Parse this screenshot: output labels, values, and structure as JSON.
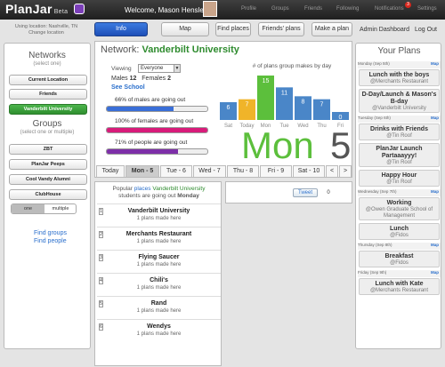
{
  "topbar": {
    "logo": "PlanJar",
    "beta": "Beta",
    "welcome": "Welcome, Mason Hensley",
    "nav": [
      "Profile",
      "Groups",
      "Friends",
      "Following",
      "Notifications",
      "Settings"
    ],
    "notification_count": "3"
  },
  "subbar": {
    "location_line1": "Using location: Nashville, TN",
    "location_line2": "Change location",
    "info_button": "Info",
    "map_button": "Map",
    "find_places": "Find places",
    "friends_plans": "Friends' plans",
    "make_plan": "Make a plan",
    "admin_dashboard": "Admin Dashboard",
    "logout": "Log Out"
  },
  "left": {
    "networks_title": "Networks",
    "networks_sub": "(select one)",
    "networks": [
      "Current Location",
      "Friends",
      "Vanderbilt University"
    ],
    "groups_title": "Groups",
    "groups_sub": "(select one or multiple)",
    "groups": [
      "ZBT",
      "PlanJar Peeps",
      "Cool Vandy Alumni",
      "ClubHouse"
    ],
    "toggle_one": "one",
    "toggle_multiple": "multiple",
    "find_groups": "Find groups",
    "find_people": "Find people"
  },
  "main": {
    "network_label": "Network:",
    "network_name": "Vanderbilt University",
    "viewing_label": "Viewing",
    "viewing_value": "Everyone",
    "males_label": "Males",
    "males_count": "12",
    "females_label": "Females",
    "females_count": "2",
    "see_school": "See School",
    "stats": [
      {
        "text": "66% of males are going out",
        "pct": 66,
        "color": "#3a6fd8"
      },
      {
        "text": "100% of females are going out",
        "pct": 100,
        "color": "#d81b7a"
      },
      {
        "text": "71% of people are going out",
        "pct": 71,
        "color": "#7d2fa8"
      }
    ],
    "chart_caption": "# of plans group makes by day",
    "big_day": "Mon",
    "big_num": "5",
    "day_tabs": [
      "Today",
      "Mon - 5",
      "Tue - 6",
      "Wed - 7",
      "Thu - 8",
      "Fri - 9",
      "Sat - 10",
      "<",
      ">"
    ]
  },
  "chart_data": {
    "type": "bar",
    "categories": [
      "Sat",
      "Today",
      "Mon",
      "Tue",
      "Wed",
      "Thu",
      "Fri"
    ],
    "values": [
      6,
      7,
      15,
      11,
      8,
      7,
      0
    ],
    "highlight": "Mon",
    "colors": [
      "#4a86c8",
      "#f0b429",
      "#5cbf3c",
      "#4a86c8",
      "#4a86c8",
      "#4a86c8",
      "#4a86c8"
    ]
  },
  "popular": {
    "head_pre": "Popular",
    "head_places": "places",
    "head_network": "Vanderbilt University",
    "head_line2_pre": "students are going out",
    "head_day": "Monday",
    "items": [
      {
        "num": "1",
        "title": "Vanderbilt University",
        "sub": "1 plans made here"
      },
      {
        "num": "2",
        "title": "Merchants Restaurant",
        "sub": "1 plans made here"
      },
      {
        "num": "3",
        "title": "Flying Saucer",
        "sub": "1 plans made here"
      },
      {
        "num": "4",
        "title": "Chili's",
        "sub": "1 plans made here"
      },
      {
        "num": "5",
        "title": "Rand",
        "sub": "1 plans made here"
      },
      {
        "num": "6",
        "title": "Wendys",
        "sub": "1 plans made here"
      }
    ]
  },
  "tweet": {
    "label": "Tweet",
    "count": "0"
  },
  "right": {
    "title": "Your Plans",
    "map_label": "Map",
    "days": [
      {
        "date": "Monday (Sep 5th)",
        "plans": [
          {
            "title": "Lunch with the boys",
            "sub": "@Merchants Restaurant"
          },
          {
            "title": "D-Day/Launch & Mason's B-day",
            "sub": "@Vanderbilt University"
          }
        ]
      },
      {
        "date": "Tuesday (Sep 6th)",
        "plans": [
          {
            "title": "Drinks with Friends",
            "sub": "@Tin Roof"
          },
          {
            "title": "PlanJar Launch Partaaayyy!",
            "sub": "@Tin Roof"
          },
          {
            "title": "Happy Hour",
            "sub": "@Tin Roof"
          }
        ]
      },
      {
        "date": "Wednesday (Sep 7th)",
        "plans": [
          {
            "title": "Working",
            "sub": "@Owen Graduate School of Management"
          },
          {
            "title": "Lunch",
            "sub": "@Fidos"
          }
        ]
      },
      {
        "date": "Thursday (Sep 8th)",
        "plans": [
          {
            "title": "Breakfast",
            "sub": "@Fidos"
          }
        ]
      },
      {
        "date": "Friday (Sep 9th)",
        "plans": [
          {
            "title": "Lunch with Kate",
            "sub": "@Merchants Restaurant"
          }
        ]
      }
    ]
  }
}
